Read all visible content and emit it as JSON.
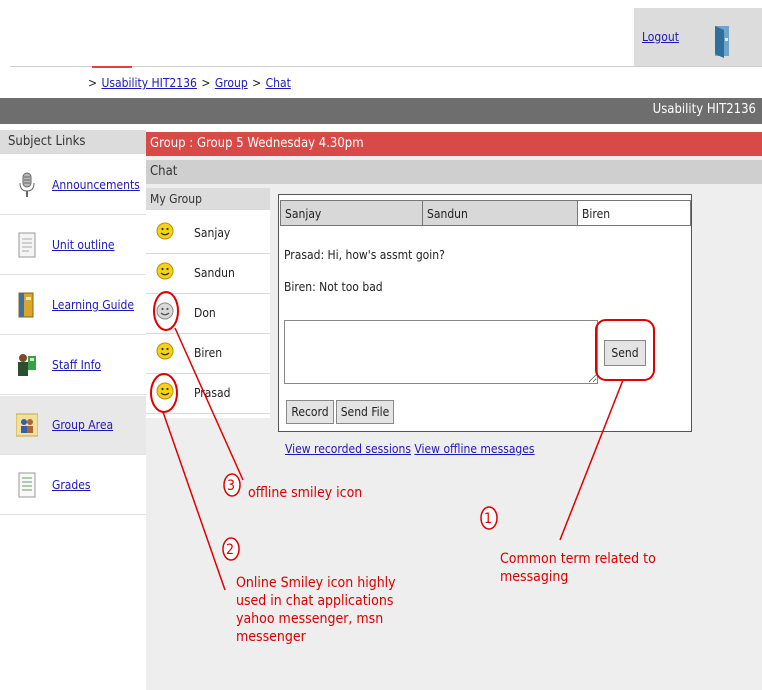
{
  "header": {
    "logout": "Logout",
    "icons": {
      "logout": "logout-door-icon"
    }
  },
  "breadcrumb": {
    "prefix": ">",
    "items": [
      "Usability HIT2136",
      "Group",
      "Chat"
    ],
    "sep": ">"
  },
  "topbar": {
    "title": "Usability HIT2136"
  },
  "sidebar": {
    "heading": "Subject Links",
    "items": [
      {
        "label": "Announcements",
        "icon": "microphone-icon"
      },
      {
        "label": "Unit outline",
        "icon": "document-icon"
      },
      {
        "label": "Learning Guide",
        "icon": "book-icon"
      },
      {
        "label": "Staff Info",
        "icon": "staff-icon"
      },
      {
        "label": "Group Area",
        "icon": "group-icon",
        "active": true
      },
      {
        "label": "Grades",
        "icon": "list-icon"
      }
    ]
  },
  "group_bar": {
    "title": "Group : Group 5 Wednesday 4.30pm"
  },
  "chat_bar": {
    "title": "Chat"
  },
  "my_group": {
    "heading": "My Group",
    "members": [
      {
        "name": "Sanjay",
        "status": "online"
      },
      {
        "name": "Sandun",
        "status": "online"
      },
      {
        "name": "Don",
        "status": "offline"
      },
      {
        "name": "Biren",
        "status": "online"
      },
      {
        "name": "Prasad",
        "status": "online"
      }
    ]
  },
  "chat": {
    "tabs": [
      "Sanjay",
      "Sandun",
      "Biren"
    ],
    "messages": [
      "Prasad: Hi, how's assmt goin?",
      "Biren: Not too bad"
    ],
    "input_value": "",
    "send": "Send",
    "record": "Record",
    "send_file": "Send File",
    "links": [
      "View recorded sessions",
      "View offline messages"
    ]
  },
  "annotations": {
    "ann1": {
      "num": "1",
      "text": [
        "Common term related to",
        "messaging"
      ]
    },
    "ann2": {
      "num": "2",
      "text": [
        "Online Smiley icon highly",
        "used in chat applications",
        "yahoo messenger, msn",
        "messenger"
      ]
    },
    "ann3": {
      "num": "3",
      "text": [
        "offline smiley icon"
      ]
    },
    "color": "#d90000"
  },
  "colors": {
    "topbar": "#6e6e6e",
    "group_bar": "#d84a48",
    "panel_gray": "#dcdcdc",
    "link": "#1a1ab8"
  }
}
